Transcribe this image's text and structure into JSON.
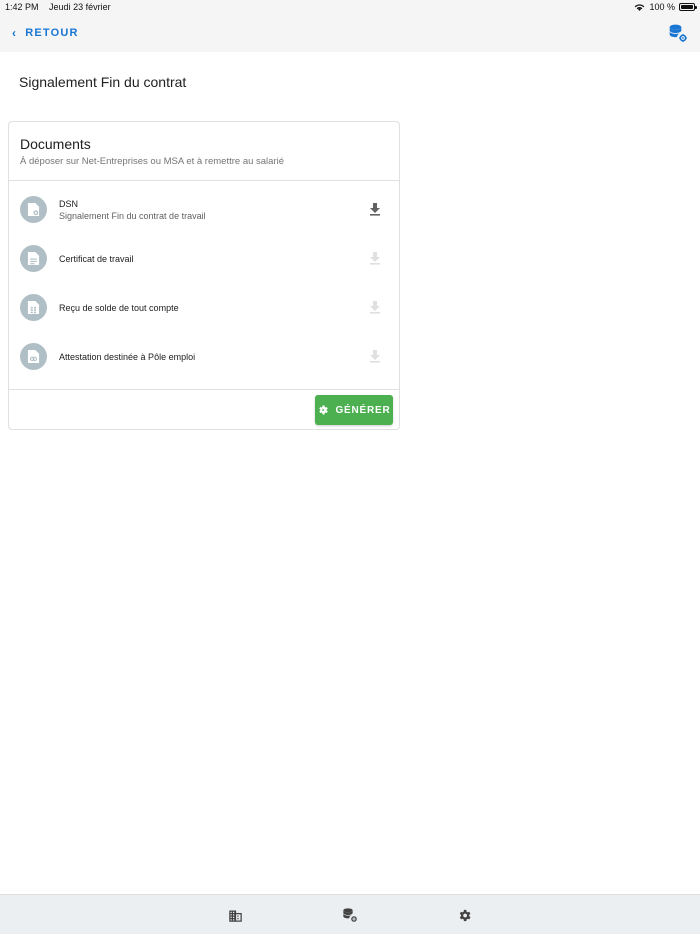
{
  "status_bar": {
    "time": "1:42 PM",
    "date": "Jeudi 23 février",
    "battery": "100 %"
  },
  "app_bar": {
    "back_label": "RETOUR",
    "back_icon": "chevron-left-icon",
    "right_icon": "database-settings-icon",
    "accent_color": "#1976d2"
  },
  "page": {
    "title": "Signalement Fin du contrat"
  },
  "card": {
    "title": "Documents",
    "subtitle": "À déposer sur Net-Entreprises ou MSA et à remettre au salarié",
    "documents": [
      {
        "title": "DSN",
        "subtitle": "Signalement Fin du contrat de travail",
        "icon": "file-settings-icon",
        "download_enabled": true
      },
      {
        "title": "Certificat de travail",
        "subtitle": "",
        "icon": "file-document-icon",
        "download_enabled": false
      },
      {
        "title": "Reçu de solde de tout compte",
        "subtitle": "",
        "icon": "file-table-icon",
        "download_enabled": false
      },
      {
        "title": "Attestation destinée à Pôle emploi",
        "subtitle": "",
        "icon": "file-link-icon",
        "download_enabled": false
      }
    ],
    "generate_label": "GÉNÉRER",
    "generate_color": "#4caf50"
  },
  "bottom_nav": {
    "items": [
      {
        "icon": "building-icon"
      },
      {
        "icon": "database-settings-icon"
      },
      {
        "icon": "gear-icon"
      }
    ]
  }
}
